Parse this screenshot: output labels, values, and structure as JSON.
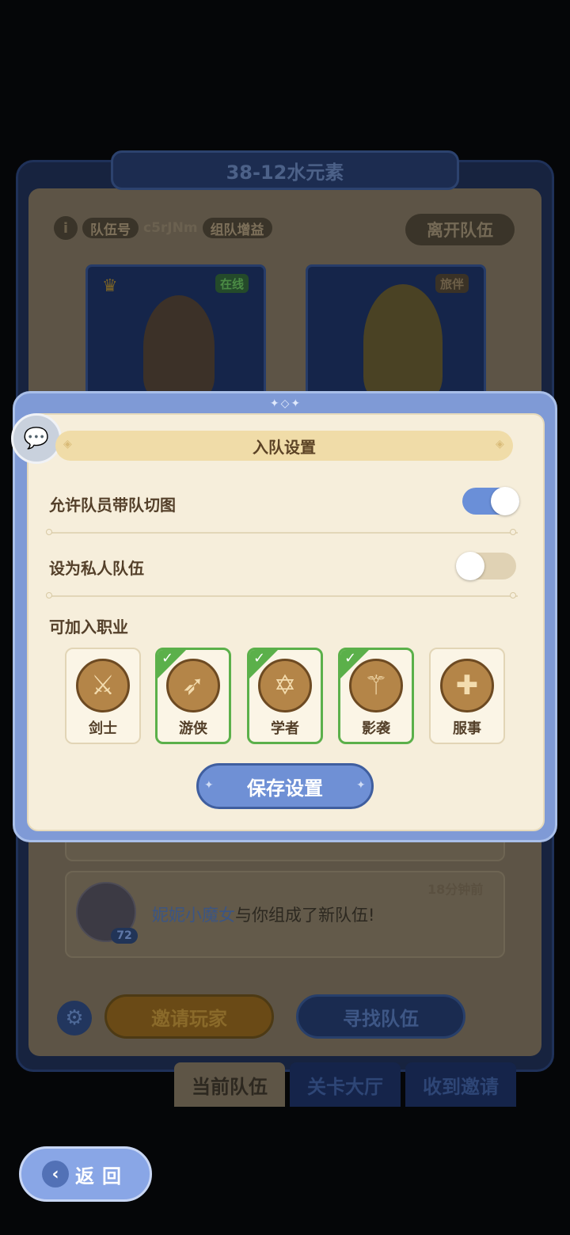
{
  "team_panel": {
    "title": "38-12水元素",
    "info_icon": "i",
    "team_no_label": "队伍号",
    "team_code": "c5rJNm",
    "team_bonus_label": "组队增益",
    "leave_label": "离开队伍",
    "members": [
      {
        "status": "在线",
        "status_color": "#2f6b2c",
        "role_icon": "crown-icon"
      },
      {
        "status": "旅伴",
        "status_color": "#5a4a33"
      }
    ]
  },
  "message": {
    "time": "18分钟前",
    "name": "妮妮小魔女",
    "text": "与你组成了新队伍!",
    "level": "72"
  },
  "actions": {
    "invite_label": "邀请玩家",
    "find_label": "寻找队伍"
  },
  "tabs": [
    {
      "label": "当前队伍",
      "active": true
    },
    {
      "label": "关卡大厅",
      "active": false
    },
    {
      "label": "收到邀请",
      "active": false
    }
  ],
  "back": {
    "label": "返回",
    "arrow": "‹"
  },
  "dialog": {
    "title": "入队设置",
    "settings": [
      {
        "label": "允许队员带队切图",
        "enabled": true
      },
      {
        "label": "设为私人队伍",
        "enabled": false
      }
    ],
    "classes_label": "可加入职业",
    "classes": [
      {
        "name": "剑士",
        "selected": false,
        "icon": "sword-icon",
        "glyph": "⚔"
      },
      {
        "name": "游侠",
        "selected": true,
        "icon": "bow-icon",
        "glyph": "➶"
      },
      {
        "name": "学者",
        "selected": true,
        "icon": "hexagram-icon",
        "glyph": "✡"
      },
      {
        "name": "影袭",
        "selected": true,
        "icon": "blade-icon",
        "glyph": "⚚"
      },
      {
        "name": "服事",
        "selected": false,
        "icon": "cross-icon",
        "glyph": "✚"
      }
    ],
    "save_label": "保存设置"
  },
  "colors": {
    "accent_blue": "#6f90d5",
    "selected_green": "#5bb04a",
    "paper": "#f6eedb"
  }
}
